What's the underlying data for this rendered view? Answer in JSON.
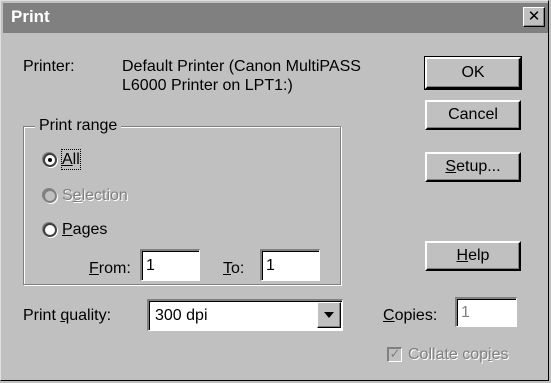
{
  "window": {
    "title": "Print",
    "close_glyph": "✕"
  },
  "printer": {
    "label": "Printer:",
    "value_line1": "Default Printer (Canon MultiPASS",
    "value_line2": "L6000 Printer on LPT1:)"
  },
  "buttons": {
    "ok": "OK",
    "cancel": "Cancel",
    "setup": "Setup...",
    "help": "Help"
  },
  "print_range": {
    "caption": "Print range",
    "options": [
      {
        "label": "All",
        "checked": true,
        "enabled": true
      },
      {
        "label": "Selection",
        "checked": false,
        "enabled": false
      },
      {
        "label": "Pages",
        "checked": false,
        "enabled": true
      }
    ],
    "from_label": "From:",
    "from_value": "1",
    "to_label": "To:",
    "to_value": "1"
  },
  "quality": {
    "label": "Print quality:",
    "value": "300 dpi"
  },
  "copies": {
    "label": "Copies:",
    "value": "1"
  },
  "collate": {
    "label": "Collate copies",
    "checked": true,
    "enabled": false
  }
}
